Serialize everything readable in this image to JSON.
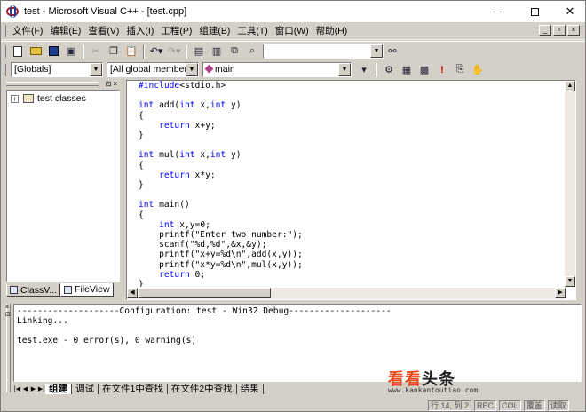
{
  "window": {
    "title": "test - Microsoft Visual C++ - [test.cpp]"
  },
  "menu": {
    "items": [
      "文件(F)",
      "编辑(E)",
      "查看(V)",
      "插入(I)",
      "工程(P)",
      "组建(B)",
      "工具(T)",
      "窗口(W)",
      "帮助(H)"
    ]
  },
  "toolbar": {
    "find_value": ""
  },
  "wizardbar": {
    "scope": "[Globals]",
    "members": "[All global members",
    "function": "main"
  },
  "workspace": {
    "tree_root": "test classes",
    "tabs": [
      "ClassV...",
      "FileView"
    ]
  },
  "editor": {
    "lines": [
      "#include<stdio.h>",
      "",
      "int add(int x,int y)",
      "{",
      "    return x+y;",
      "}",
      "",
      "int mul(int x,int y)",
      "{",
      "    return x*y;",
      "}",
      "",
      "int main()",
      "{",
      "    int x,y=0;",
      "    printf(\"Enter two number:\");",
      "    scanf(\"%d,%d\",&x,&y);",
      "    printf(\"x+y=%d\\n\",add(x,y));",
      "    printf(\"x*y=%d\\n\",mul(x,y));",
      "    return 0;",
      "}"
    ]
  },
  "output": {
    "lines": [
      "--------------------Configuration: test - Win32 Debug--------------------",
      "Linking...",
      "",
      "test.exe - 0 error(s), 0 warning(s)"
    ],
    "tabs": [
      "组建",
      "调试",
      "在文件1中查找",
      "在文件2中查找",
      "结果"
    ]
  },
  "statusbar": {
    "position": "行 14, 列 2",
    "rec": "REC",
    "col": "COL",
    "ovr": "覆盖",
    "read": "读取"
  },
  "watermark": {
    "title_a": "看看",
    "title_b": "头条",
    "url": "www.kankantoutiao.com"
  }
}
